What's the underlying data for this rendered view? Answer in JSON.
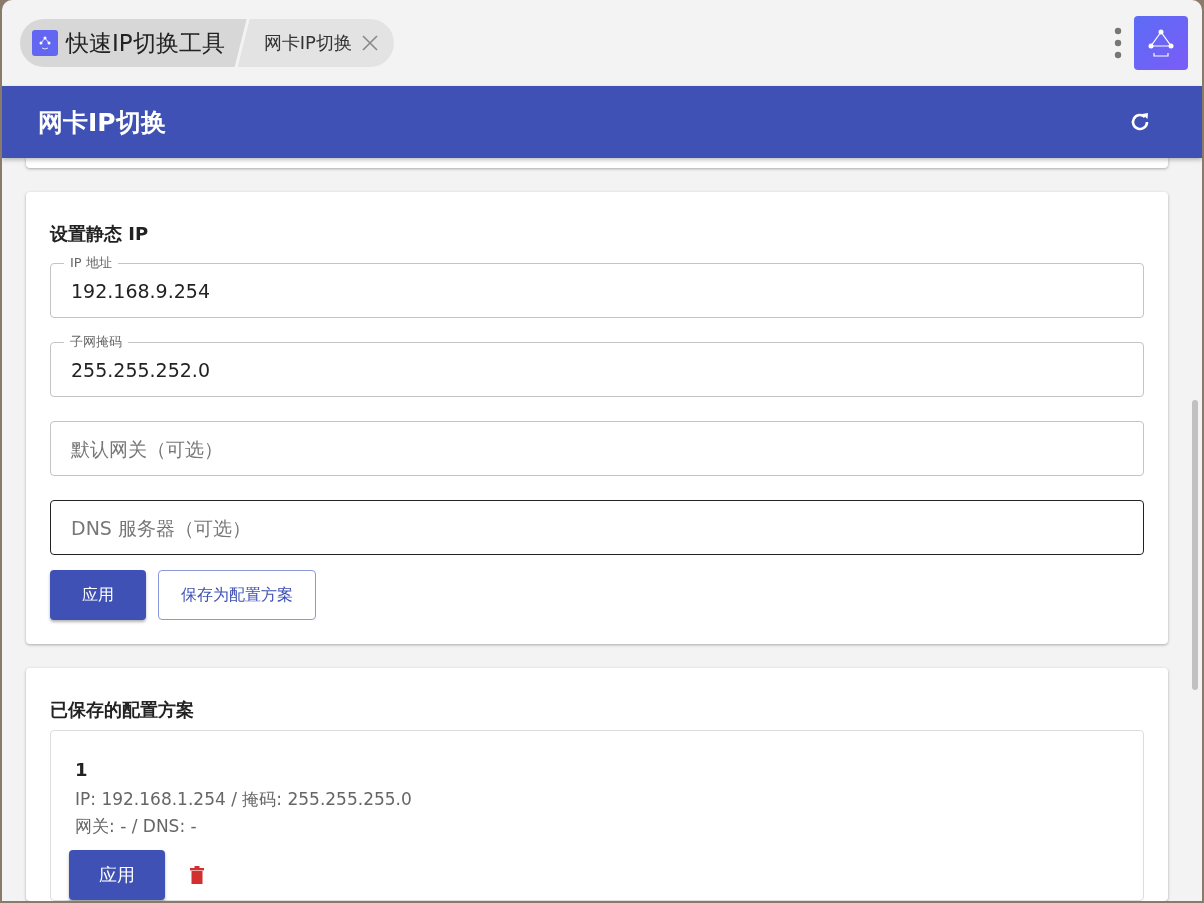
{
  "tabs": [
    {
      "label": "快速IP切换工具",
      "selected": true,
      "closable": false
    },
    {
      "label": "网卡IP切换",
      "selected": false,
      "closable": true
    }
  ],
  "header": {
    "title": "网卡IP切换"
  },
  "static_ip": {
    "title": "设置静态 IP",
    "fields": [
      {
        "label": "IP 地址",
        "value": "192.168.9.254",
        "focused": false
      },
      {
        "label": "子网掩码",
        "value": "255.255.252.0",
        "focused": false
      },
      {
        "placeholder": "默认网关（可选）",
        "focused": false
      },
      {
        "placeholder": "DNS 服务器（可选）",
        "focused": true
      }
    ],
    "buttons": [
      {
        "label": "应用",
        "kind": "primary"
      },
      {
        "label": "保存为配置方案",
        "kind": "outlined"
      }
    ]
  },
  "saved": {
    "title": "已保存的配置方案",
    "profiles": [
      {
        "name": "1",
        "line_1": "IP: 192.168.1.254 / 掩码: 255.255.255.0",
        "line_2": "网关: - / DNS: -",
        "apply": "应用"
      }
    ]
  }
}
